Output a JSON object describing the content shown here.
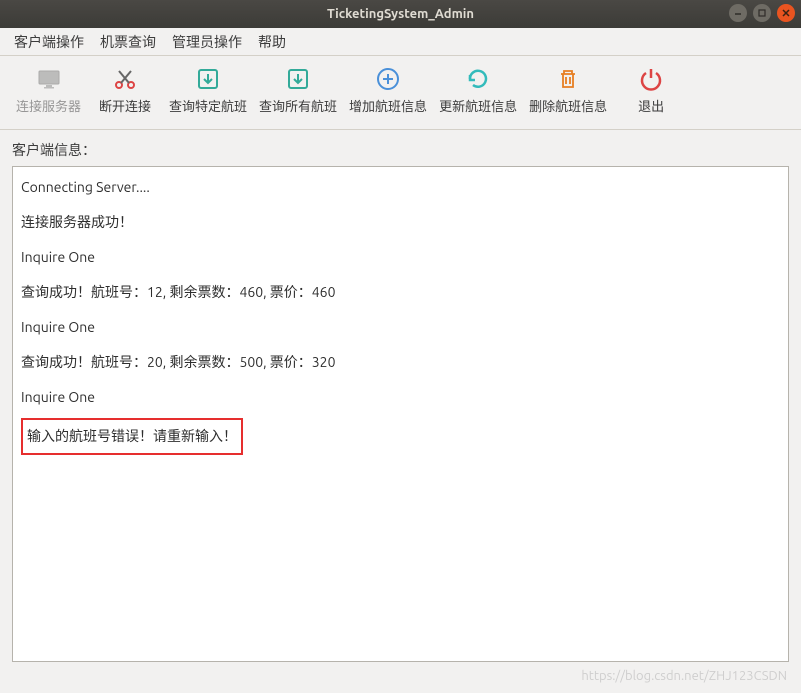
{
  "window": {
    "title": "TicketingSystem_Admin"
  },
  "menubar": {
    "items": [
      {
        "label": "客户端操作"
      },
      {
        "label": "机票查询"
      },
      {
        "label": "管理员操作"
      },
      {
        "label": "帮助"
      }
    ]
  },
  "toolbar": {
    "connect_label": "连接服务器",
    "disconnect_label": "断开连接",
    "query_one_label": "查询特定航班",
    "query_all_label": "查询所有航班",
    "add_label": "增加航班信息",
    "update_label": "更新航班信息",
    "delete_label": "删除航班信息",
    "exit_label": "退出"
  },
  "section": {
    "client_info_label": "客户端信息："
  },
  "log": {
    "lines": [
      "Connecting Server....",
      "连接服务器成功！",
      "Inquire One",
      "查询成功！航班号：12, 剩余票数：460, 票价：460",
      "Inquire One",
      "查询成功！航班号：20, 剩余票数：500, 票价：320",
      "Inquire One"
    ],
    "highlighted": "输入的航班号错误！请重新输入！"
  },
  "watermark": "https://blog.csdn.net/ZHJ123CSDN"
}
